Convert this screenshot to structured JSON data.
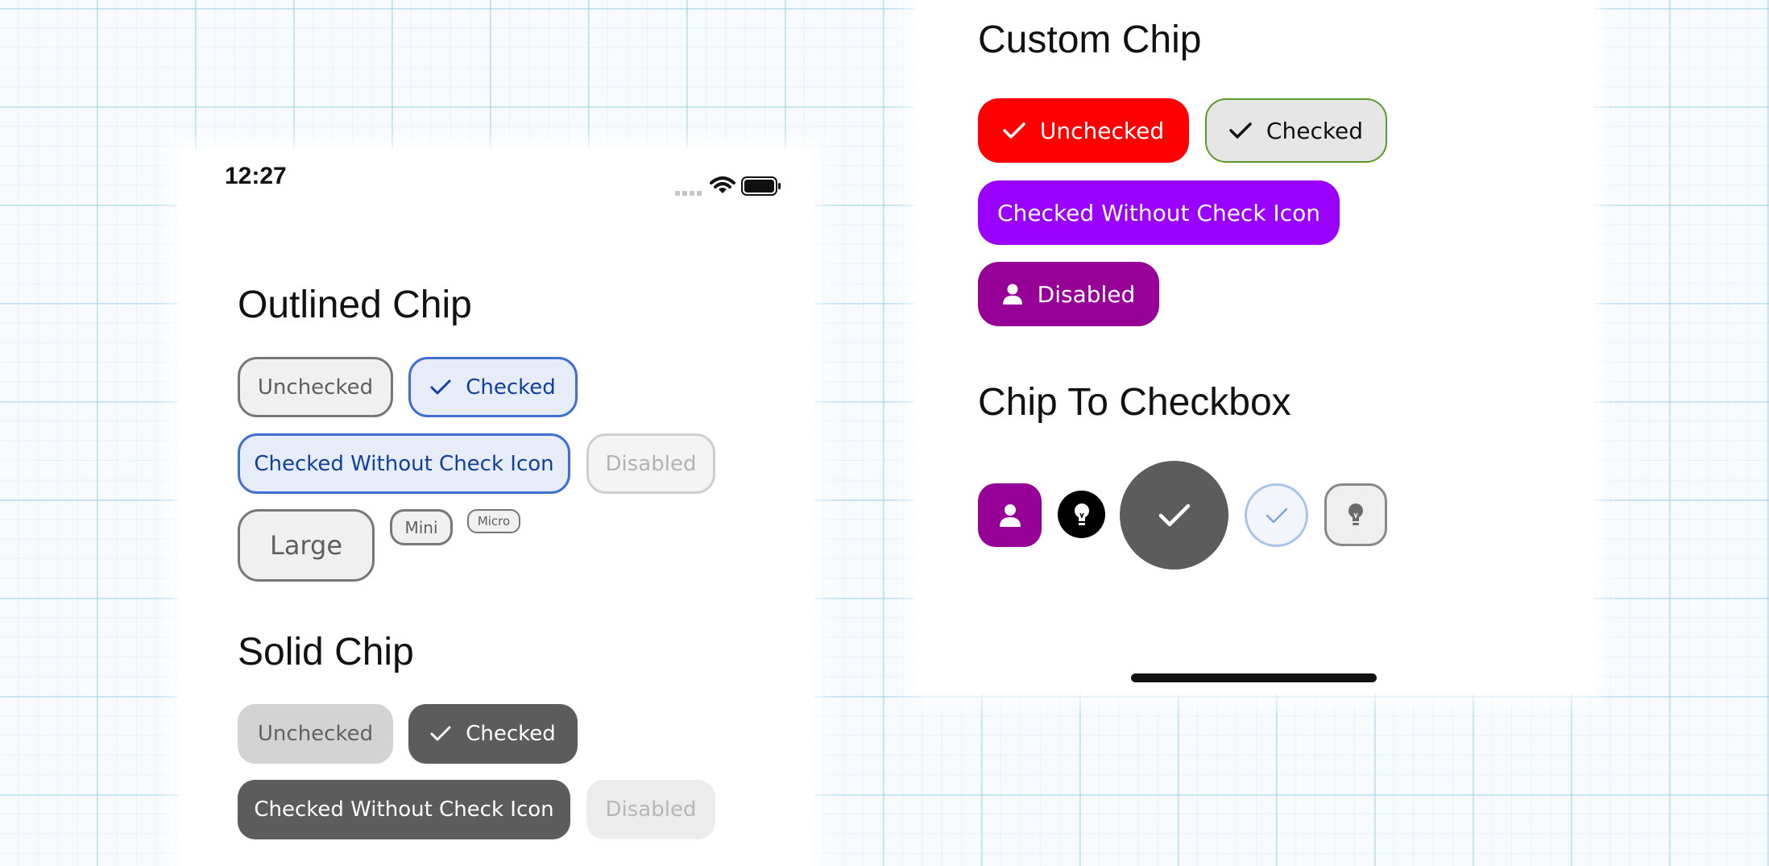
{
  "status_bar": {
    "time": "12:27"
  },
  "outlined": {
    "title": "Outlined Chip",
    "unchecked": "Unchecked",
    "checked": "Checked",
    "checked_no_icon": "Checked Without Check Icon",
    "disabled": "Disabled",
    "large": "Large",
    "mini": "Mini",
    "micro": "Micro"
  },
  "solid": {
    "title": "Solid Chip",
    "unchecked": "Unchecked",
    "checked": "Checked",
    "checked_no_icon": "Checked Without Check Icon",
    "disabled": "Disabled"
  },
  "custom": {
    "title": "Custom Chip",
    "unchecked": "Unchecked",
    "checked": "Checked",
    "checked_no_icon": "Checked Without Check Icon",
    "disabled": "Disabled"
  },
  "checkbox": {
    "title": "Chip To Checkbox",
    "items": [
      {
        "icon": "person-icon",
        "state": "checked"
      },
      {
        "icon": "lightbulb-icon",
        "state": "checked"
      },
      {
        "icon": "checkmark-icon",
        "state": "checked"
      },
      {
        "icon": "checkmark-icon",
        "state": "unchecked"
      },
      {
        "icon": "lightbulb-icon",
        "state": "unchecked"
      }
    ]
  },
  "colors": {
    "custom_red": "#ff0000",
    "custom_green_border": "#5b9a2a",
    "custom_purple": "#9a00ff",
    "custom_disabled": "#960096",
    "outline_checked_border": "#3f6fd0",
    "solid_checked": "#5c5c5c"
  }
}
